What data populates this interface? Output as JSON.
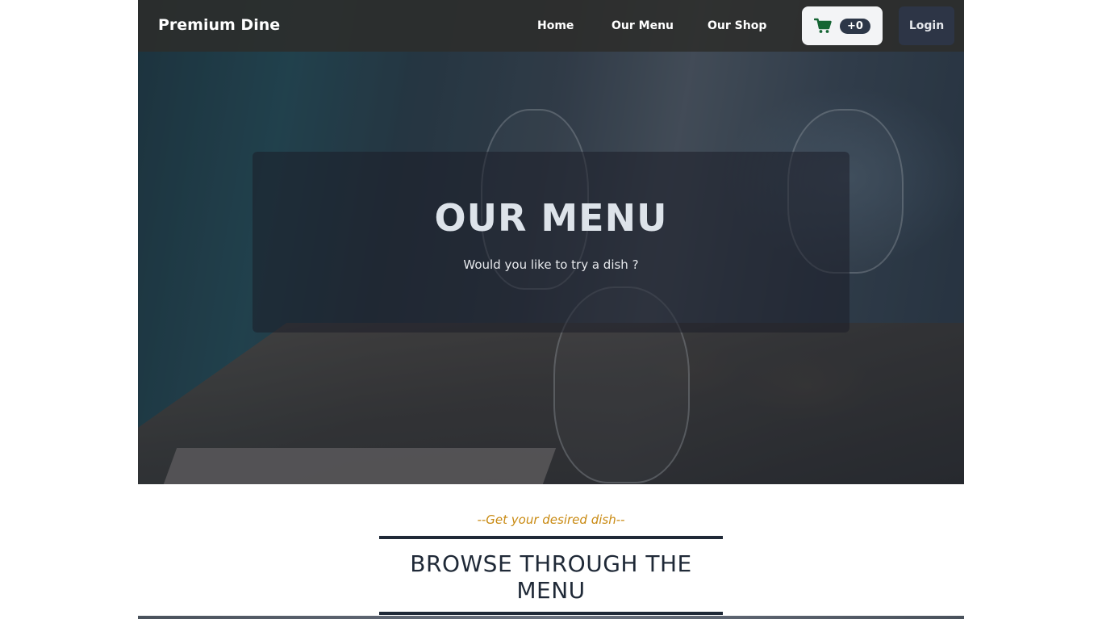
{
  "navbar": {
    "brand": "Premium Dine",
    "links": [
      {
        "label": "Home"
      },
      {
        "label": "Our Menu"
      },
      {
        "label": "Our Shop"
      }
    ],
    "cart": {
      "icon": "shopping-cart-icon",
      "count": "+0",
      "icon_color": "#166534"
    },
    "login_label": "Login"
  },
  "hero": {
    "title": "OUR MENU",
    "subtitle": "Would you like to try a dish ?"
  },
  "section": {
    "kicker": "--Get your desired dish--",
    "heading": "BROWSE THROUGH THE MENU"
  },
  "colors": {
    "accent": "#c98a12",
    "dark": "#1f2937",
    "cart_badge": "#2d3748"
  }
}
